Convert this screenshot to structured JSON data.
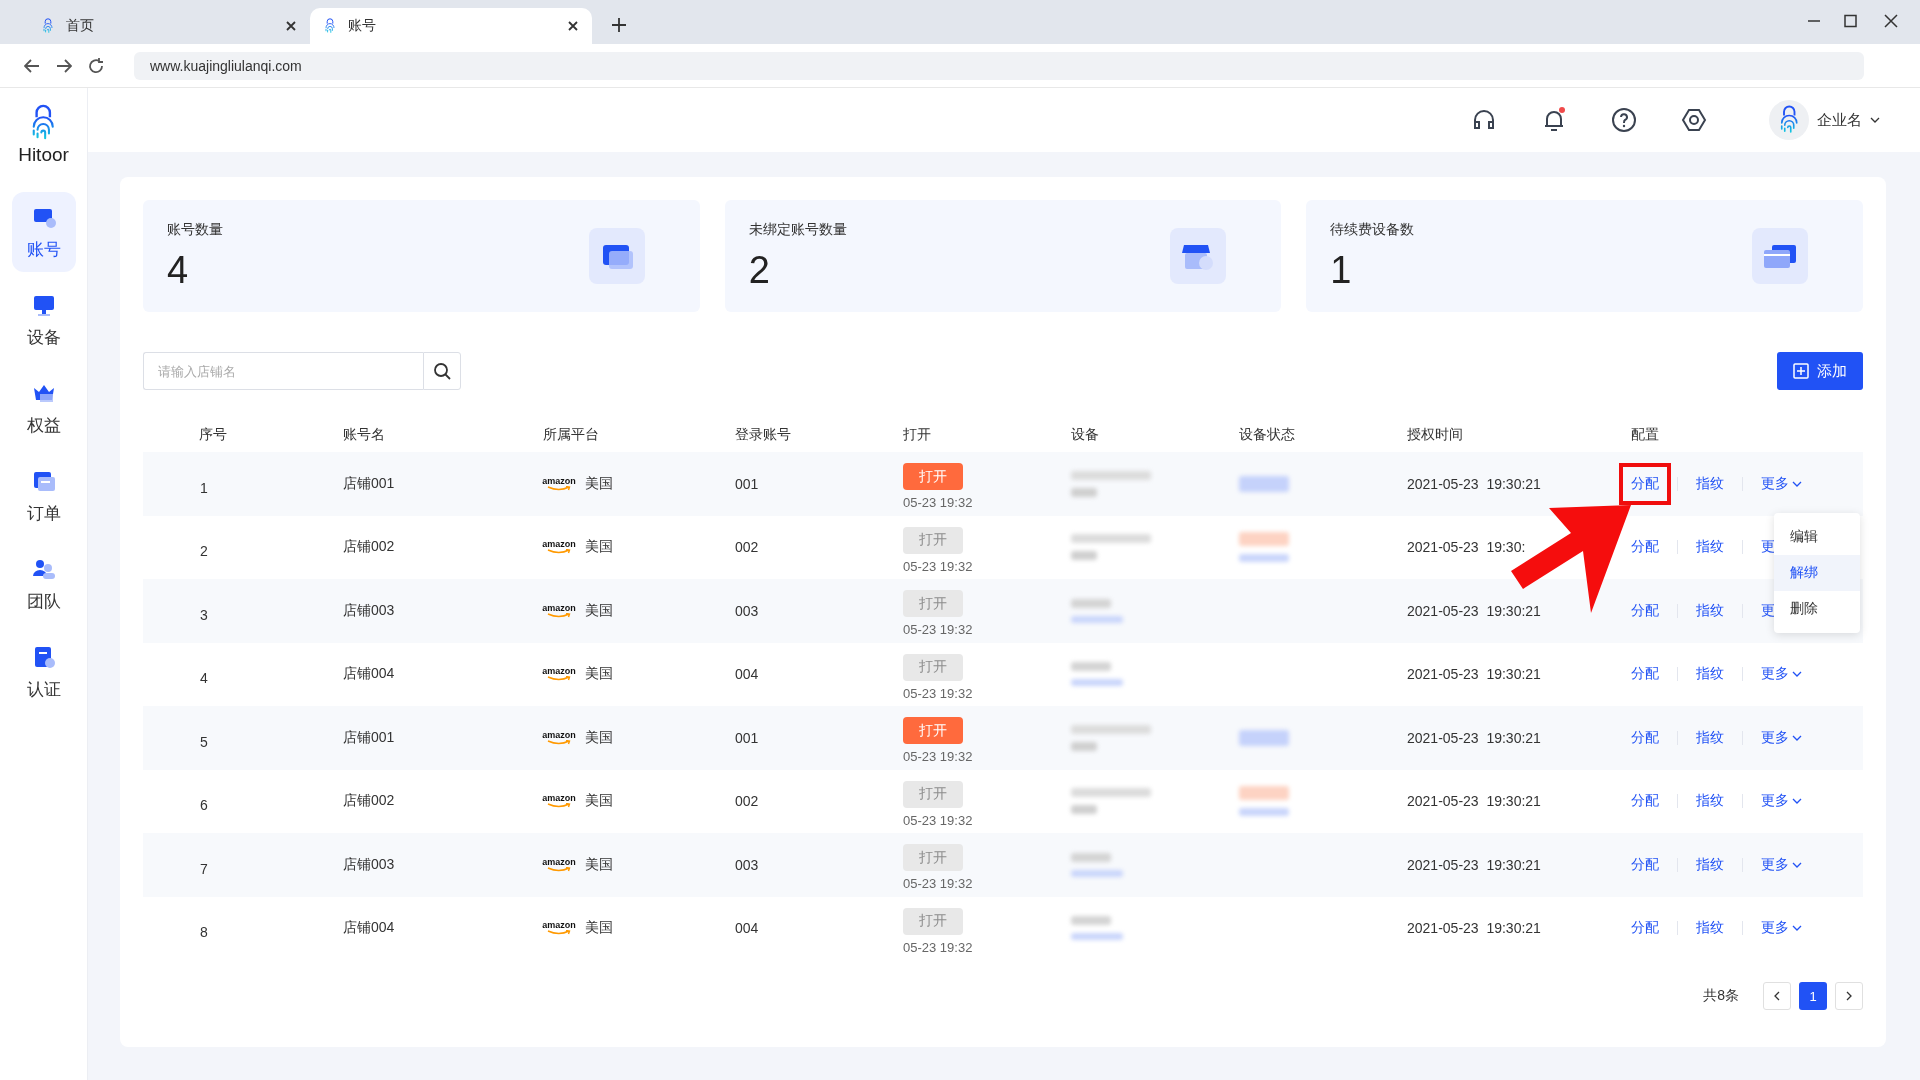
{
  "browser": {
    "tabs": [
      {
        "label": "首页",
        "selected": false
      },
      {
        "label": "账号",
        "selected": true
      }
    ],
    "url": "www.kuajingliulanqi.com"
  },
  "sidebar": {
    "logo": "Hitoor",
    "items": [
      {
        "label": "账号",
        "selected": true
      },
      {
        "label": "设备",
        "selected": false
      },
      {
        "label": "权益",
        "selected": false
      },
      {
        "label": "订单",
        "selected": false
      },
      {
        "label": "团队",
        "selected": false
      },
      {
        "label": "认证",
        "selected": false
      }
    ]
  },
  "header": {
    "company": "企业名",
    "notification_dot": true
  },
  "stats": [
    {
      "label": "账号数量",
      "value": "4"
    },
    {
      "label": "未绑定账号数量",
      "value": "2"
    },
    {
      "label": "待续费设备数",
      "value": "1"
    }
  ],
  "search": {
    "placeholder": "请输入店铺名"
  },
  "add_button": "添加",
  "table": {
    "columns": [
      "序号",
      "账号名",
      "所属平台",
      "登录账号",
      "打开",
      "设备",
      "设备状态",
      "授权时间",
      "配置"
    ],
    "rows": [
      {
        "index": "1",
        "name": "店铺001",
        "platform_logo": "amazon",
        "region": "美国",
        "login": "001",
        "open": "打开",
        "open_enabled": true,
        "open_time": "05-23 19:32",
        "device": {
          "kind": "long"
        },
        "device_status": {
          "kind": "blue"
        },
        "auth_time": "2021-05-23  19:30:21",
        "assign": "分配",
        "fingerprint": "指纹",
        "more": "更多",
        "more_arrow": true,
        "highlighted": true
      },
      {
        "index": "2",
        "name": "店铺002",
        "platform_logo": "amazon",
        "region": "美国",
        "login": "002",
        "open": "打开",
        "open_enabled": false,
        "open_time": "05-23 19:32",
        "device": {
          "kind": "long"
        },
        "device_status": {
          "kind": "orange"
        },
        "auth_time": "2021-05-23  19:30:",
        "assign": "分配",
        "fingerprint": "指纹",
        "more": "更",
        "more_arrow": false,
        "highlighted": false
      },
      {
        "index": "3",
        "name": "店铺003",
        "platform_logo": "amazon",
        "region": "美国",
        "login": "003",
        "open": "打开",
        "open_enabled": false,
        "open_time": "05-23 19:32",
        "device": {
          "kind": "short"
        },
        "auth_time": "2021-05-23  19:30:21",
        "assign": "分配",
        "fingerprint": "指纹",
        "more": "更",
        "more_arrow": false,
        "highlighted": false
      },
      {
        "index": "4",
        "name": "店铺004",
        "platform_logo": "amazon",
        "region": "美国",
        "login": "004",
        "open": "打开",
        "open_enabled": false,
        "open_time": "05-23 19:32",
        "device": {
          "kind": "short"
        },
        "auth_time": "2021-05-23  19:30:21",
        "assign": "分配",
        "fingerprint": "指纹",
        "more": "更多",
        "more_arrow": true,
        "highlighted": false
      },
      {
        "index": "5",
        "name": "店铺001",
        "platform_logo": "amazon",
        "region": "美国",
        "login": "001",
        "open": "打开",
        "open_enabled": true,
        "open_time": "05-23 19:32",
        "device": {
          "kind": "long"
        },
        "device_status": {
          "kind": "blue"
        },
        "auth_time": "2021-05-23  19:30:21",
        "assign": "分配",
        "fingerprint": "指纹",
        "more": "更多",
        "more_arrow": true,
        "highlighted": false
      },
      {
        "index": "6",
        "name": "店铺002",
        "platform_logo": "amazon",
        "region": "美国",
        "login": "002",
        "open": "打开",
        "open_enabled": false,
        "open_time": "05-23 19:32",
        "device": {
          "kind": "long"
        },
        "device_status": {
          "kind": "orange"
        },
        "auth_time": "2021-05-23  19:30:21",
        "assign": "分配",
        "fingerprint": "指纹",
        "more": "更多",
        "more_arrow": true,
        "highlighted": false
      },
      {
        "index": "7",
        "name": "店铺003",
        "platform_logo": "amazon",
        "region": "美国",
        "login": "003",
        "open": "打开",
        "open_enabled": false,
        "open_time": "05-23 19:32",
        "device": {
          "kind": "short"
        },
        "auth_time": "2021-05-23  19:30:21",
        "assign": "分配",
        "fingerprint": "指纹",
        "more": "更多",
        "more_arrow": true,
        "highlighted": false
      },
      {
        "index": "8",
        "name": "店铺004",
        "platform_logo": "amazon",
        "region": "美国",
        "login": "004",
        "open": "打开",
        "open_enabled": false,
        "open_time": "05-23 19:32",
        "device": {
          "kind": "short"
        },
        "auth_time": "2021-05-23  19:30:21",
        "assign": "分配",
        "fingerprint": "指纹",
        "more": "更多",
        "more_arrow": true,
        "highlighted": false
      }
    ]
  },
  "dropdown": {
    "items": [
      {
        "label": "编辑",
        "selected": false
      },
      {
        "label": "解绑",
        "selected": true
      },
      {
        "label": "删除",
        "selected": false
      }
    ]
  },
  "pagination": {
    "total": "共8条",
    "pages": [
      {
        "label": "1",
        "selected": true
      }
    ]
  }
}
